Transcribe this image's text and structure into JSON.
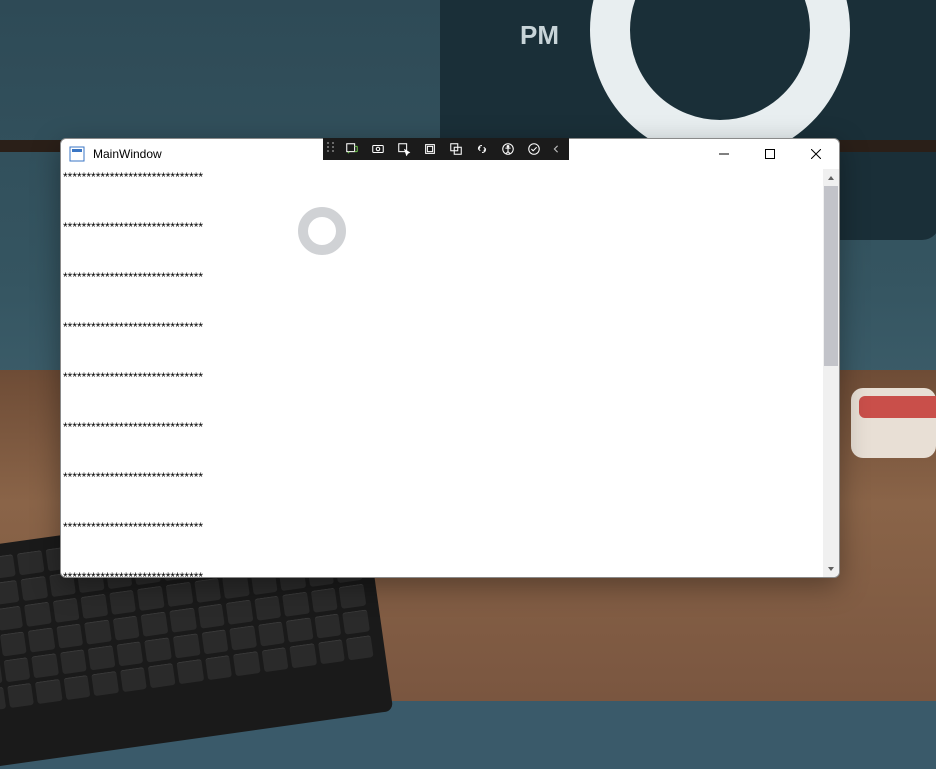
{
  "desktop": {
    "clock_suffix": "PM"
  },
  "window": {
    "title": "MainWindow",
    "content_lines": [
      "******************************",
      "******************************",
      "******************************",
      "******************************",
      "******************************",
      "******************************",
      "******************************",
      "******************************",
      "******************************"
    ]
  },
  "debug_toolbar": {
    "items": [
      "live-visual-tree-icon",
      "hot-reload-icon",
      "select-element-icon",
      "display-layout-adorners-icon",
      "track-focus-icon",
      "binding-diagnostics-icon",
      "accessibility-icon",
      "scan-icon"
    ]
  }
}
